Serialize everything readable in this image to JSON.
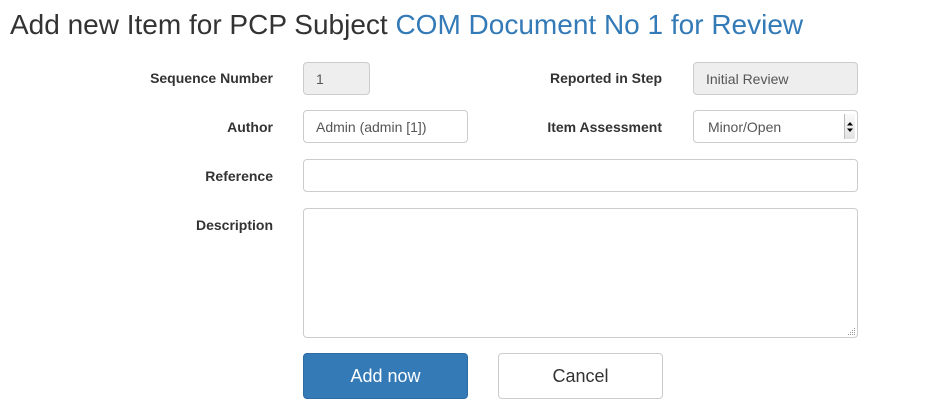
{
  "header": {
    "title_prefix": "Add new Item for PCP Subject",
    "subject_link": "COM Document No 1 for Review"
  },
  "form": {
    "sequence_number": {
      "label": "Sequence Number",
      "value": "1"
    },
    "reported_in_step": {
      "label": "Reported in Step",
      "value": "Initial Review"
    },
    "author": {
      "label": "Author",
      "value": "Admin (admin [1])"
    },
    "item_assessment": {
      "label": "Item Assessment",
      "selected": "Minor/Open"
    },
    "reference": {
      "label": "Reference",
      "value": ""
    },
    "description": {
      "label": "Description",
      "value": ""
    }
  },
  "actions": {
    "add_label": "Add now",
    "cancel_label": "Cancel"
  },
  "colors": {
    "primary": "#337ab7",
    "link": "#337ab7",
    "readonly_bg": "#eeeeee",
    "border": "#cccccc"
  }
}
